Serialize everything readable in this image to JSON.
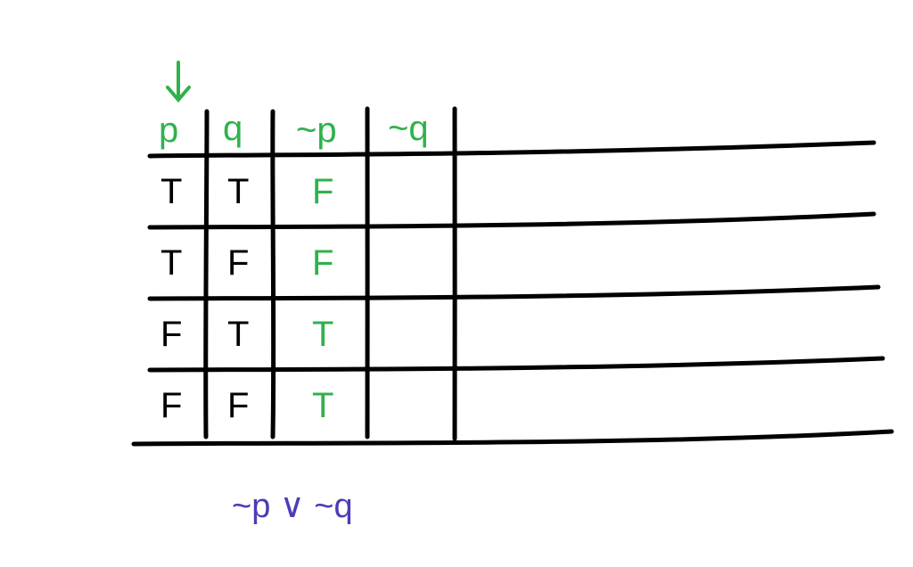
{
  "truth_table": {
    "arrow_target": "p",
    "headers": {
      "p": "p",
      "q": "q",
      "not_p": "~p",
      "not_q": "~q"
    },
    "rows": [
      {
        "p": "T",
        "q": "T",
        "not_p": "F",
        "not_q": ""
      },
      {
        "p": "T",
        "q": "F",
        "not_p": "F",
        "not_q": ""
      },
      {
        "p": "F",
        "q": "T",
        "not_p": "T",
        "not_q": ""
      },
      {
        "p": "F",
        "q": "F",
        "not_p": "T",
        "not_q": ""
      }
    ]
  },
  "bottom_expression": "~p ∨ ~q",
  "colors": {
    "green": "#2fb24c",
    "black": "#000000",
    "pen": "#4a3db8"
  }
}
